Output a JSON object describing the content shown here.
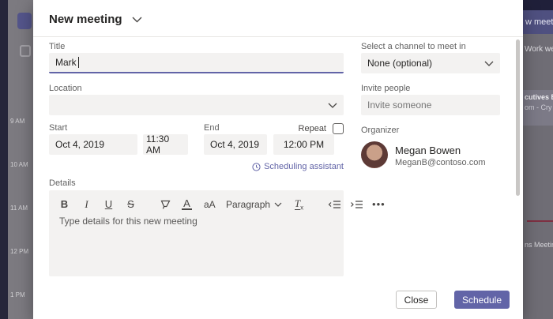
{
  "dialog": {
    "header": {
      "title": "New meeting"
    },
    "left": {
      "title_label": "Title",
      "title_value": "Mark",
      "location_label": "Location",
      "start_label": "Start",
      "start_date": "Oct 4, 2019",
      "start_time": "11:30 AM",
      "end_label": "End",
      "end_date": "Oct 4, 2019",
      "end_time": "12:00 PM",
      "repeat_label": "Repeat",
      "scheduling_assistant": "Scheduling assistant",
      "details_label": "Details",
      "details_placeholder": "Type details for this new meeting"
    },
    "toolbar": {
      "bold": "B",
      "italic": "I",
      "underline": "U",
      "strikethrough": "S",
      "font_color": "A",
      "font_size": "aA",
      "paragraph": "Paragraph",
      "clear_format_t": "T",
      "clear_format_x": "x",
      "more": "•••"
    },
    "right": {
      "channel_label": "Select a channel to meet in",
      "channel_value": "None (optional)",
      "invite_label": "Invite people",
      "invite_placeholder": "Invite someone",
      "organizer_label": "Organizer",
      "organizer_name": "Megan Bowen",
      "organizer_email": "MeganB@contoso.com"
    },
    "footer": {
      "close": "Close",
      "schedule": "Schedule"
    }
  },
  "background": {
    "time_labels": [
      "9 AM",
      "10 AM",
      "11 AM",
      "12 PM",
      "1 PM"
    ],
    "right_fragments": {
      "new_meeting_button": "w meeti",
      "work_week": "Work we",
      "event_line1": "cutives Bi",
      "event_line2": "om - Cry",
      "meeting_label": "ns Meetin"
    }
  },
  "colors": {
    "accent": "#6264a7",
    "input_bg": "#f3f2f1"
  }
}
